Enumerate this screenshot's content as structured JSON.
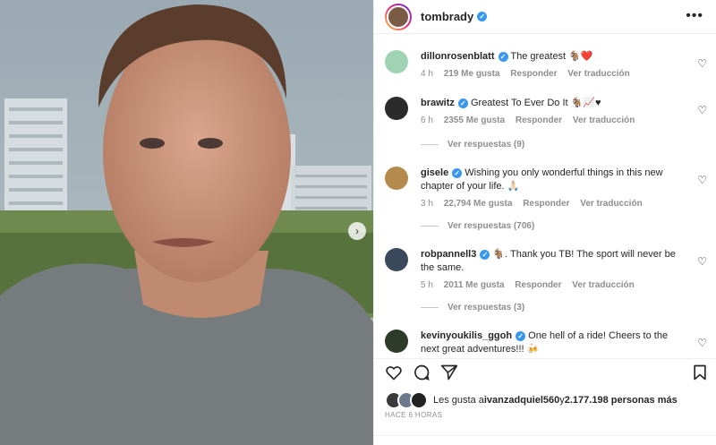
{
  "post": {
    "username": "tombrady",
    "more_icon": "more-horizontal-icon"
  },
  "comments": [
    {
      "user": "dillonrosenblatt",
      "text": "The greatest 🐐❤️",
      "time": "4 h",
      "likes": "219 Me gusta",
      "reply": "Responder",
      "translate": "Ver traducción"
    },
    {
      "user": "brawitz",
      "text": "Greatest To Ever Do It 🐐📈♥",
      "time": "6 h",
      "likes": "2355 Me gusta",
      "reply": "Responder",
      "translate": "Ver traducción",
      "replies": "Ver respuestas (9)"
    },
    {
      "user": "gisele",
      "text": "Wishing you only wonderful things in this new chapter of your life. 🙏🏻",
      "time": "3 h",
      "likes": "22,794 Me gusta",
      "reply": "Responder",
      "translate": "Ver traducción",
      "replies": "Ver respuestas (706)"
    },
    {
      "user": "robpannell3",
      "text": "🐐. Thank you TB! The sport will never be the same.",
      "time": "5 h",
      "likes": "2011 Me gusta",
      "reply": "Responder",
      "translate": "Ver traducción",
      "replies": "Ver respuestas (3)"
    },
    {
      "user": "kevinyoukilis_ggoh",
      "text": "One hell of a ride! Cheers to the next great adventures!!! 🍻"
    }
  ],
  "likes_line": {
    "prefix": "Les gusta a ",
    "user": "ivanzadquiel560",
    "middle": " y ",
    "count": "2.177.198 personas más"
  },
  "time_ago": "HACE 6 HORAS",
  "colors": {
    "verified": "#3897f0",
    "muted": "#8e8e8e",
    "text": "#262626"
  }
}
